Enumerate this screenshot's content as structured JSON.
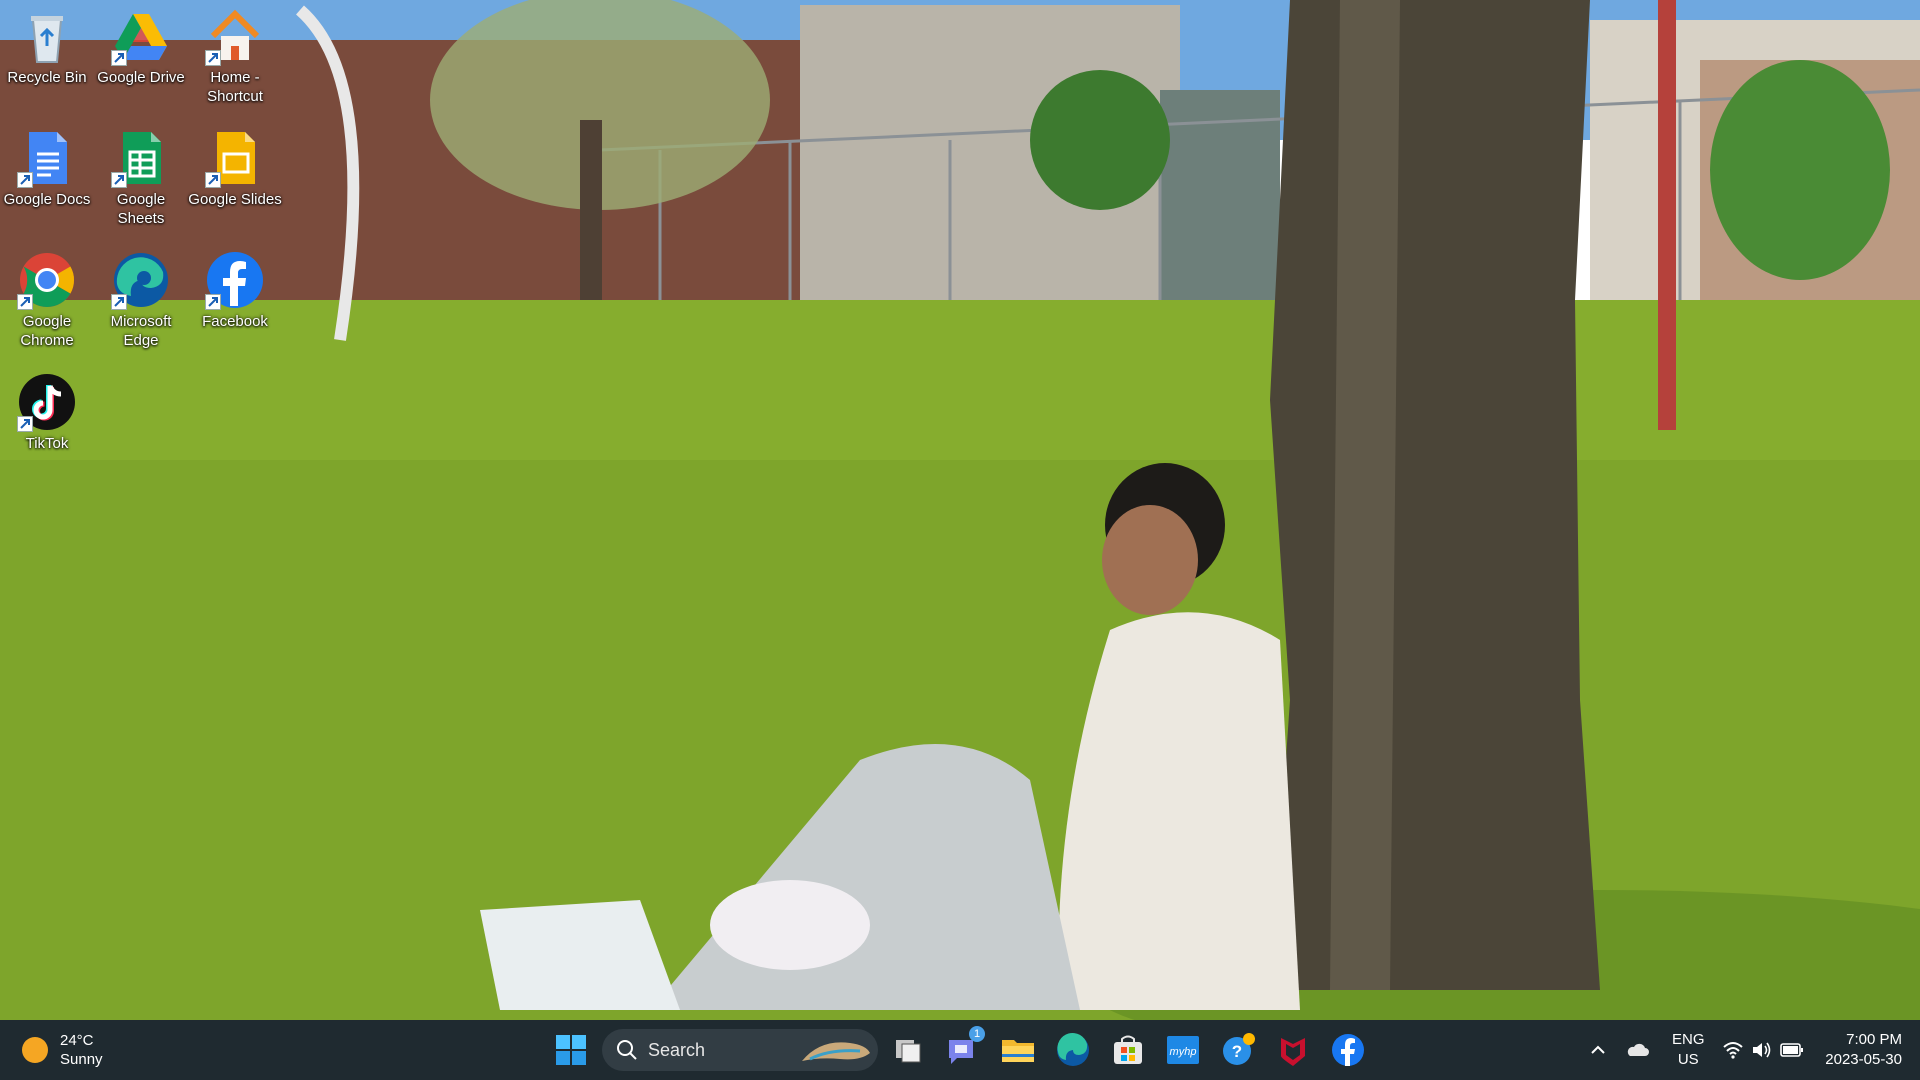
{
  "desktop": {
    "icons": [
      {
        "label": "Recycle Bin",
        "icon": "recycle-bin-icon"
      },
      {
        "label": "Google Drive",
        "icon": "google-drive-icon"
      },
      {
        "label": "Home - Shortcut",
        "icon": "home-icon"
      },
      {
        "label": "Google Docs",
        "icon": "google-docs-icon"
      },
      {
        "label": "Google Sheets",
        "icon": "google-sheets-icon"
      },
      {
        "label": "Google Slides",
        "icon": "google-slides-icon"
      },
      {
        "label": "Google Chrome",
        "icon": "chrome-icon"
      },
      {
        "label": "Microsoft Edge",
        "icon": "edge-icon"
      },
      {
        "label": "Facebook",
        "icon": "facebook-icon"
      },
      {
        "label": "TikTok",
        "icon": "tiktok-icon"
      }
    ]
  },
  "taskbar": {
    "weather": {
      "temp": "24°C",
      "condition": "Sunny"
    },
    "search": {
      "label": "Search"
    },
    "pinned_apps": [
      {
        "name": "Task View",
        "icon": "task-view-icon"
      },
      {
        "name": "Teams Chat",
        "icon": "teams-chat-icon",
        "badge": "1"
      },
      {
        "name": "File Explorer",
        "icon": "file-explorer-icon"
      },
      {
        "name": "Microsoft Edge",
        "icon": "edge-icon"
      },
      {
        "name": "Microsoft Store",
        "icon": "store-icon"
      },
      {
        "name": "myHP",
        "icon": "myhp-icon"
      },
      {
        "name": "Get Help",
        "icon": "help-icon"
      },
      {
        "name": "McAfee",
        "icon": "mcafee-icon"
      },
      {
        "name": "Facebook",
        "icon": "facebook-icon"
      }
    ],
    "tray": {
      "language": "ENG",
      "region": "US",
      "time": "7:00 PM",
      "date": "2023-05-30"
    }
  },
  "colors": {
    "taskbar_bg": "#1f2a30",
    "accent": "#0078d4"
  }
}
